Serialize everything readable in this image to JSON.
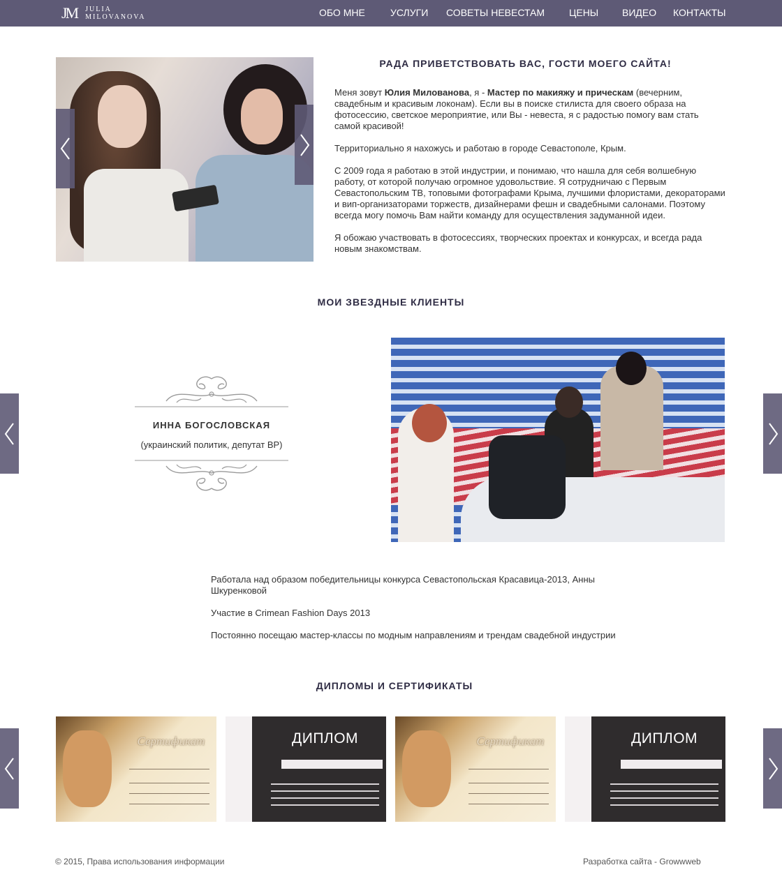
{
  "header": {
    "logo_mark": "JM",
    "logo_line1": "JULIA",
    "logo_line2": "MILOVANOVA",
    "nav": [
      "ОБО МНЕ",
      "УСЛУГИ",
      "СОВЕТЫ НЕВЕСТАМ",
      "ЦЕНЫ",
      "ВИДЕО",
      "КОНТАКТЫ"
    ]
  },
  "hero": {
    "title": "РАДА ПРИВЕТСТВОВАТЬ ВАС, ГОСТИ МОЕГО САЙТА!",
    "intro_1": "Меня зовут ",
    "intro_name": "Юлия Милованова",
    "intro_2": ", я - ",
    "intro_role": "Мастер по макияжу и прическам",
    "intro_3": " (вечерним, свадебным и красивым локонам). Если вы в поиске стилиста для своего образа на фотосессию, светское мероприятие, или Вы - невеста, я с радостью помогу вам стать самой красивой!",
    "paragraph_2": "Территориально я нахожусь и работаю в городе Севастополе, Крым.",
    "paragraph_3": "С 2009 года я работаю в этой индустрии, и понимаю, что нашла для себя волшебную работу, от которой получаю огромное удовольствие. Я сотрудничаю с Первым Севастопольским ТВ, топовыми фотографами Крыма, лучшими флористами, декораторами и вип-организаторами торжеств, дизайнерами фешн и свадебными салонами. Поэтому всегда могу помочь Вам найти команду для осуществления задуманной идеи.",
    "paragraph_4": "Я обожаю участвовать в фотосессиях, творческих проектах и конкурсах, и всегда рада новым знакомствам."
  },
  "clients": {
    "title": "МОИ ЗВЕЗДНЫЕ КЛИЕНТЫ",
    "name": "ИННА БОГОСЛОВСКАЯ",
    "role": "(украинский политик, депутат ВР)"
  },
  "info": {
    "line_1": "Работала над образом победительницы конкурса Севастопольская Красавица-2013, Анны Шкуренковой",
    "line_2": "Участие в Crimean Fashion Days 2013",
    "line_3": "Постоянно посещаю мастер-классы по модным направлениям и трендам свадебной индустрии"
  },
  "diplomas": {
    "title": "ДИПЛОМЫ И СЕРТИФИКАТЫ",
    "cert_label": "Сертификат",
    "diploma_label": "ДИПЛОМ"
  },
  "footer": {
    "left": "© 2015, Права использования информации",
    "right": "Разработка сайта - Growwweb"
  },
  "colors": {
    "header_bg": "#5e5a76",
    "title_color": "#2f2c44"
  }
}
